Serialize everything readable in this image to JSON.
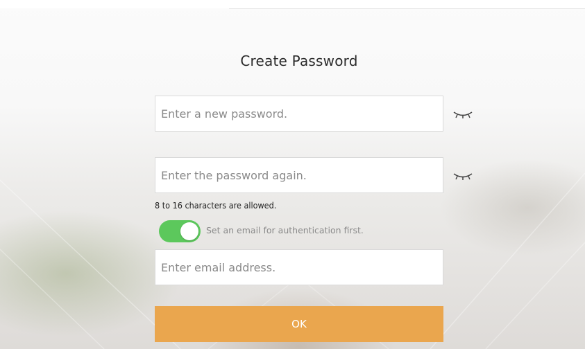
{
  "form": {
    "title": "Create Password",
    "new_password": {
      "value": "",
      "placeholder": "Enter a new password."
    },
    "confirm_password": {
      "value": "",
      "placeholder": "Enter the password again."
    },
    "hint": "8 to 16 characters are allowed.",
    "email_toggle": {
      "on": true,
      "label": "Set an email for authentication first."
    },
    "email": {
      "value": "",
      "placeholder": "Enter email address."
    },
    "ok_label": "OK"
  },
  "icons": {
    "password_visibility": "eye-closed-icon",
    "confirm_visibility": "eye-closed-icon"
  },
  "colors": {
    "accent": "#eaa64e",
    "toggle_on": "#5cc85c",
    "field_border": "#d9d9d9",
    "title_text": "#2a2a2a",
    "placeholder_text": "#8a8a8a"
  }
}
